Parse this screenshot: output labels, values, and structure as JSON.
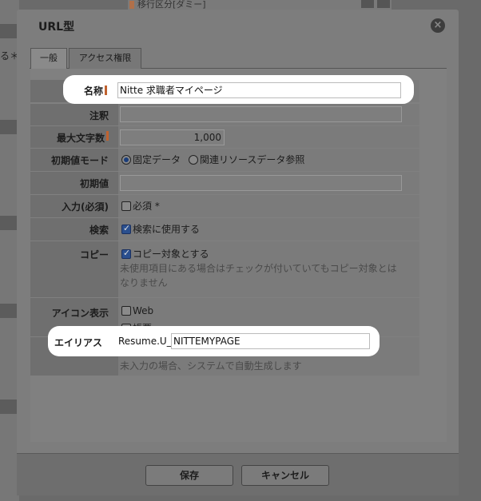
{
  "background": {
    "left_text": "る＊",
    "top_strip_text": "移行区分[ダミー]"
  },
  "dialog": {
    "title": "URL型",
    "close_icon": "×",
    "tabs": [
      {
        "label": "一般",
        "active": true
      },
      {
        "label": "アクセス権限",
        "active": false
      }
    ]
  },
  "form": {
    "name": {
      "label": "名称",
      "required": true,
      "value": "Nitte 求職者マイページ"
    },
    "annotation": {
      "label": "注釈",
      "value": ""
    },
    "max_chars": {
      "label": "最大文字数",
      "required": true,
      "value": "1,000"
    },
    "initial_mode": {
      "label": "初期値モード",
      "options": [
        "固定データ",
        "関連リソースデータ参照"
      ],
      "selected": "固定データ"
    },
    "initial_value": {
      "label": "初期値",
      "value": ""
    },
    "input_required": {
      "label": "入力(必須)",
      "checkbox_label": "必須 *",
      "checked": false
    },
    "search": {
      "label": "検索",
      "checkbox_label": "検索に使用する",
      "checked": true
    },
    "copy": {
      "label": "コピー",
      "checkbox_label": "コピー対象とする",
      "checked": true,
      "note_line1": "未使用項目にある場合はチェックが付いていてもコピー対象とは",
      "note_line2": "なりません"
    },
    "icon_display": {
      "label": "アイコン表示",
      "options": [
        {
          "label": "Web",
          "checked": false
        },
        {
          "label": "帳票",
          "checked": false
        }
      ]
    },
    "alias": {
      "label": "エイリアス",
      "prefix": "Resume.U_",
      "value": "NITTEMYPAGE",
      "note": "未入力の場合、システムで自動生成します"
    }
  },
  "footer": {
    "save_label": "保存",
    "cancel_label": "キャンセル"
  },
  "colors": {
    "required_marker": "#c0622f",
    "checkbox_checked": "#2a4f8e",
    "highlight": "#ffffff"
  }
}
